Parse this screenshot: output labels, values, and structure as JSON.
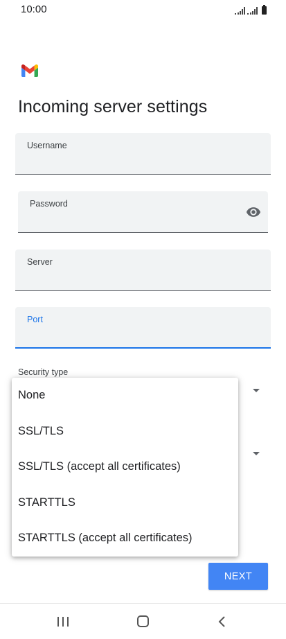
{
  "status": {
    "time": "10:00",
    "icons": [
      "signal-icon",
      "signal-icon",
      "battery-icon"
    ]
  },
  "app": {
    "logo": "gmail-logo-icon"
  },
  "title": "Incoming server settings",
  "fields": {
    "username": {
      "label": "Username",
      "value": ""
    },
    "password": {
      "label": "Password",
      "value": "",
      "icon": "eye-icon"
    },
    "server": {
      "label": "Server",
      "value": ""
    },
    "port": {
      "label": "Port",
      "value": ""
    }
  },
  "security": {
    "label": "Security type",
    "options": [
      "None",
      "SSL/TLS",
      "SSL/TLS (accept all certificates)",
      "STARTTLS",
      "STARTTLS (accept all certificates)"
    ]
  },
  "buttons": {
    "next": "NEXT"
  },
  "nav": {
    "icons": [
      "recents-icon",
      "home-icon",
      "back-icon"
    ]
  },
  "colors": {
    "accent": "#1a73e8",
    "button": "#4285f4",
    "field_bg": "#f1f3f4"
  }
}
